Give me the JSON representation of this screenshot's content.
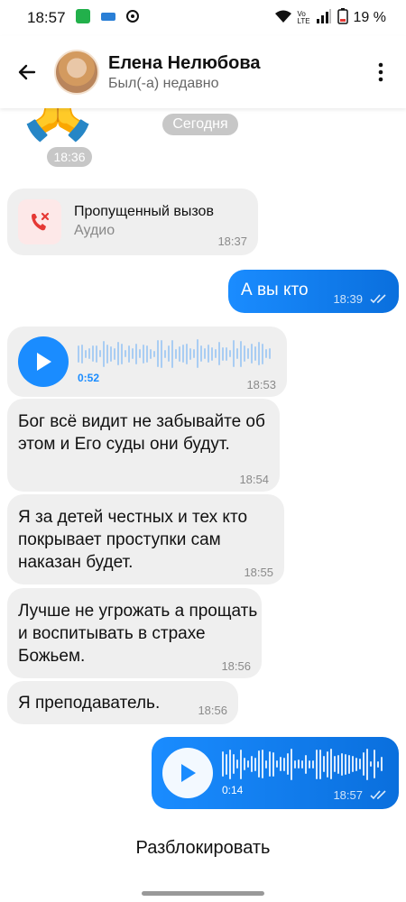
{
  "status_bar": {
    "time": "18:57",
    "network": "Vo LTE",
    "battery": "19 %"
  },
  "header": {
    "contact_name": "Елена Нелюбова",
    "last_seen": "Был(-а) недавно"
  },
  "chat": {
    "date_separator": "Сегодня",
    "emoji_message": {
      "emoji": "🙏",
      "time": "18:36"
    },
    "missed_call": {
      "title": "Пропущенный вызов",
      "subtitle": "Аудио",
      "time": "18:37"
    },
    "messages": [
      {
        "text": "А вы кто",
        "time": "18:39",
        "direction": "out"
      },
      {
        "text": "Бог всё видит не забывайте об этом и Его суды они будут.",
        "time": "18:54",
        "direction": "in"
      },
      {
        "text": "Я за детей честных и тех кто покрывает проступки сам наказан будет.",
        "time": "18:55",
        "direction": "in"
      },
      {
        "text": "Лучше не угрожать а прощать и воспитывать в страхе Божьем.",
        "time": "18:56",
        "direction": "in"
      },
      {
        "text": "Я преподаватель.",
        "time": "18:56",
        "direction": "in"
      }
    ],
    "voice_in": {
      "duration": "0:52",
      "time": "18:53"
    },
    "voice_out": {
      "duration": "0:14",
      "time": "18:57"
    }
  },
  "footer": {
    "unblock_label": "Разблокировать"
  },
  "colors": {
    "accent": "#1a8cff",
    "bubble_in": "#efefef",
    "missed_red": "#e53935"
  },
  "icons": [
    "back-arrow-icon",
    "more-vert-icon",
    "phone-missed-icon",
    "play-icon",
    "double-check-icon",
    "wifi-icon",
    "signal-icon",
    "battery-icon"
  ]
}
